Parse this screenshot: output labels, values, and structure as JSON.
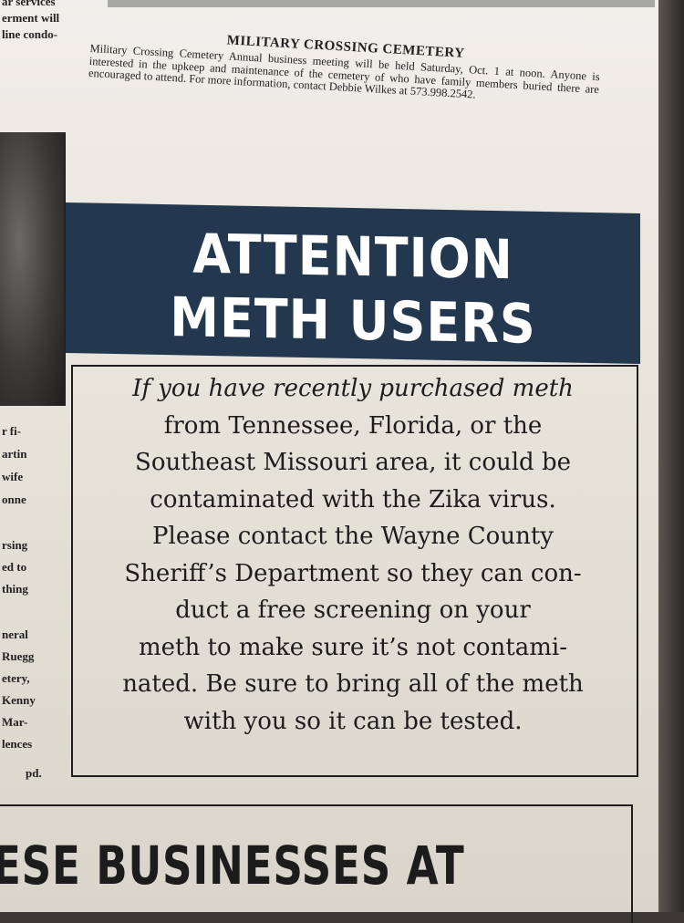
{
  "left_column": {
    "fragments": [
      "ar services",
      "erment will",
      "line condo-",
      "r fi-",
      "artin",
      "wife",
      "onne",
      "rsing",
      "ed to",
      "thing",
      "neral",
      "Ruegg",
      "etery,",
      "Kenny",
      "Mar-",
      "lences",
      "pd."
    ]
  },
  "notice": {
    "title": "MILITARY CROSSING CEMETERY",
    "body": "Military Crossing Cemetery Annual business meeting will be held Saturday, Oct. 1 at noon. Anyone is interested in the upkeep and maintenance of the cemetery of who have family members buried there are encouraged to attend. For more information, contact Debbie Wilkes at 573.998.2542."
  },
  "ad": {
    "headline_line1": "ATTENTION",
    "headline_line2": "METH USERS",
    "lines": [
      "If you have recently purchased meth",
      "from Tennessee, Florida, or the",
      "Southeast Missouri area, it could be",
      "contaminated with the Zika virus.",
      "Please contact the Wayne County",
      "Sheriff’s Department so they can con-",
      "duct a free screening on your",
      "meth to make sure it’s not contami-",
      "nated. Be sure to bring all of the meth",
      "with you so it can be tested."
    ]
  },
  "bottom": {
    "headline": "ESE BUSINESSES AT"
  },
  "colors": {
    "header_bg": "#23384f",
    "paper": "#e6e3da"
  }
}
